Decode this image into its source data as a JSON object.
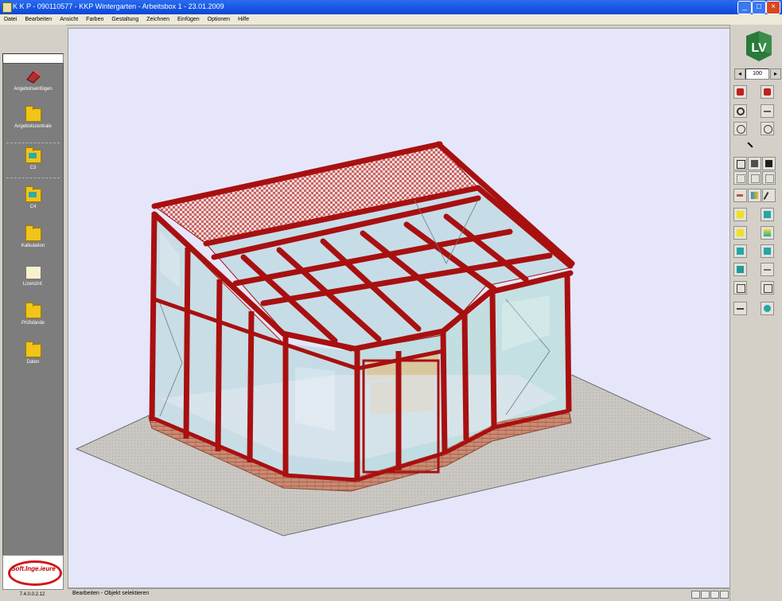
{
  "window": {
    "title": "K K P - 090110577 - KKP Wintergarten - Arbeitsbox 1 - 23.01.2009",
    "buttons": {
      "minimize": "_",
      "maximize": "□",
      "close": "×"
    }
  },
  "menu": [
    "Datei",
    "Bearbeiten",
    "Ansicht",
    "Farben",
    "Gestaltung",
    "Zeichnen",
    "Einfügen",
    "Optionen",
    "Hilfe"
  ],
  "sidebar": {
    "items": [
      {
        "label": "Angebotseinfügen",
        "icon": "quote-icon"
      },
      {
        "label": "Angebotszentrale",
        "icon": "folder-documents-icon"
      },
      {
        "label": "C3",
        "icon": "folder-teal-icon"
      },
      {
        "label": "C4",
        "icon": "folder-teal-icon"
      },
      {
        "label": "Kalkulation",
        "icon": "calculator-folder-icon"
      },
      {
        "label": "Lizenzinf.",
        "icon": "document-folder-icon"
      },
      {
        "label": "Prüfstände",
        "icon": "folder-icon"
      },
      {
        "label": "Daten",
        "icon": "folder-icon"
      }
    ],
    "logo_text": "Soft.Inge.ieure",
    "version": "7.4.0.0.2.12"
  },
  "toolbar": {
    "logo_text": "LV",
    "zoom_value": "100"
  },
  "status": {
    "text": "Bearbeiten - Objekt selektieren"
  },
  "colors": {
    "frame": "#b01818",
    "glass": "#c8dde6",
    "brick": "#c88870",
    "floor": "#c8c5c0",
    "background": "#e6e6fa"
  }
}
